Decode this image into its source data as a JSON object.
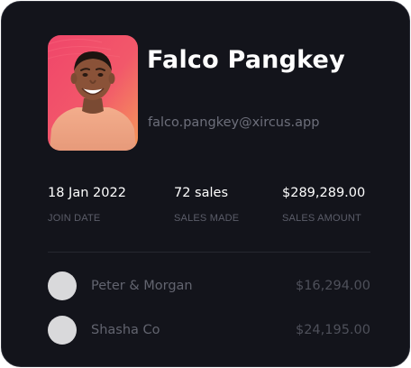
{
  "profile": {
    "name": "Falco Pangkey",
    "email": "falco.pangkey@xircus.app",
    "avatar_icon": "person-photo"
  },
  "stats": [
    {
      "value": "18 Jan 2022",
      "label": "JOIN DATE"
    },
    {
      "value": "72 sales",
      "label": "SALES MADE"
    },
    {
      "value": "$289,289.00",
      "label": "SALES AMOUNT"
    }
  ],
  "clients": [
    {
      "name": "Peter & Morgan",
      "amount": "$16,294.00"
    },
    {
      "name": "Shasha Co",
      "amount": "$24,195.00"
    }
  ],
  "colors": {
    "card_background": "#13141b",
    "avatar_gradient_top": "#f0466a",
    "avatar_gradient_bottom": "#f59a5a",
    "primary_text": "#ffffff",
    "muted_text": "#6d6f7b"
  }
}
